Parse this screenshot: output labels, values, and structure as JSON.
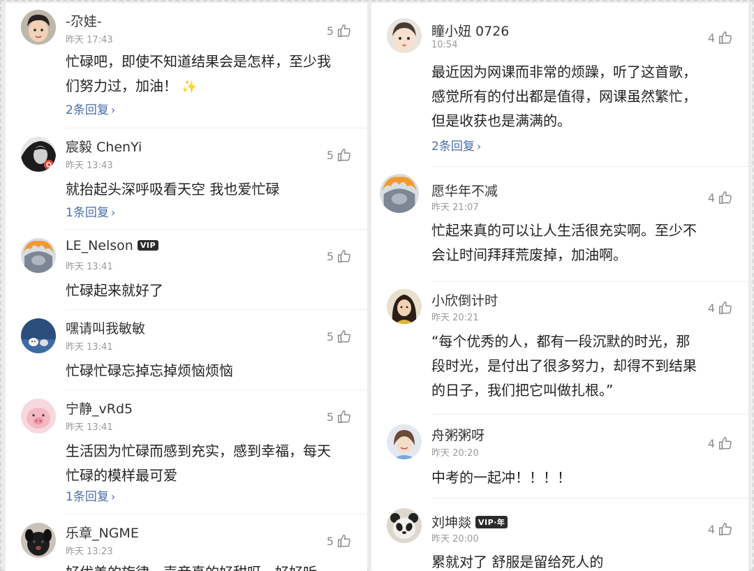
{
  "columns": {
    "left": [
      {
        "username": "-尕娃-",
        "timestamp": "昨天 17:43",
        "likes": "5",
        "body": [
          "忙碌吧，即使不知道结果会是怎样，至少我",
          "们努力过，加油！"
        ],
        "emoji": "✨",
        "reply": "2条回复",
        "avatar": "boy-face-avatar"
      },
      {
        "username": "宸毅 ChenYi",
        "timestamp": "昨天 13:43",
        "likes": "5",
        "body": [
          "就抬起头深呼吸看天空 我也爱忙碌"
        ],
        "reply": "1条回复",
        "avatar": "dark-portrait-avatar"
      },
      {
        "username": "LE_Nelson",
        "badge": "VIP",
        "timestamp": "昨天 13:41",
        "likes": "5",
        "body": [
          "忙碌起来就好了"
        ],
        "avatar": "fire-sculpture-avatar"
      },
      {
        "username": "嘿请叫我敏敏",
        "timestamp": "昨天 13:41",
        "likes": "5",
        "body": [
          "忙碌忙碌忘掉忘掉烦恼烦恼"
        ],
        "avatar": "blue-cartoon-avatar"
      },
      {
        "username": "宁静_vRd5",
        "timestamp": "昨天 13:41",
        "likes": "5",
        "body": [
          "生活因为忙碌而感到充实，感到幸福，每天",
          "忙碌的模样最可爱"
        ],
        "reply": "1条回复",
        "avatar": "pink-pig-avatar"
      },
      {
        "username": "乐章_NGME",
        "timestamp": "昨天 13:23",
        "likes": "5",
        "body": [
          "好优美的旋律，声音真的好甜呀，好好听"
        ],
        "avatar": "black-dog-avatar"
      }
    ],
    "right": [
      {
        "username": "瞳小妞 0726",
        "timestamp": "10:54",
        "likes": "4",
        "body": [
          "最近因为网课而非常的烦躁，听了这首歌，",
          "感觉所有的付出都是值得，网课虽然繁忙，",
          "但是收获也是满满的。"
        ],
        "reply": "2条回复",
        "avatar": "child-face-avatar"
      },
      {
        "username": "愿华年不减",
        "timestamp": "昨天 21:07",
        "likes": "4",
        "body": [
          "忙起来真的可以让人生活很充实啊。至少不",
          "会让时间拜拜荒废掉，加油啊。"
        ],
        "avatar": "fire-sculpture-avatar"
      },
      {
        "username": "小欣倒计时",
        "timestamp": "昨天 20:21",
        "likes": "4",
        "body": [
          "“每个优秀的人，都有一段沉默的时光，那",
          "段时光，是付出了很多努力，却得不到结果",
          "的日子，我们把它叫做扎根。”"
        ],
        "avatar": "woman-portrait-avatar"
      },
      {
        "username": "舟粥粥呀",
        "timestamp": "昨天 20:20",
        "likes": "4",
        "body": [
          "中考的一起冲！！！！"
        ],
        "avatar": "smiling-girl-avatar"
      },
      {
        "username": "刘坤燚",
        "badge": "VIP·年",
        "timestamp": "昨天 20:00",
        "likes": "4",
        "body": [
          "累就对了 舒服是留给死人的"
        ],
        "avatar": "panda-avatar"
      }
    ]
  },
  "colors": {
    "reply_link": "#4a6ea9",
    "text": "#222222",
    "meta": "#9a9a9a"
  }
}
